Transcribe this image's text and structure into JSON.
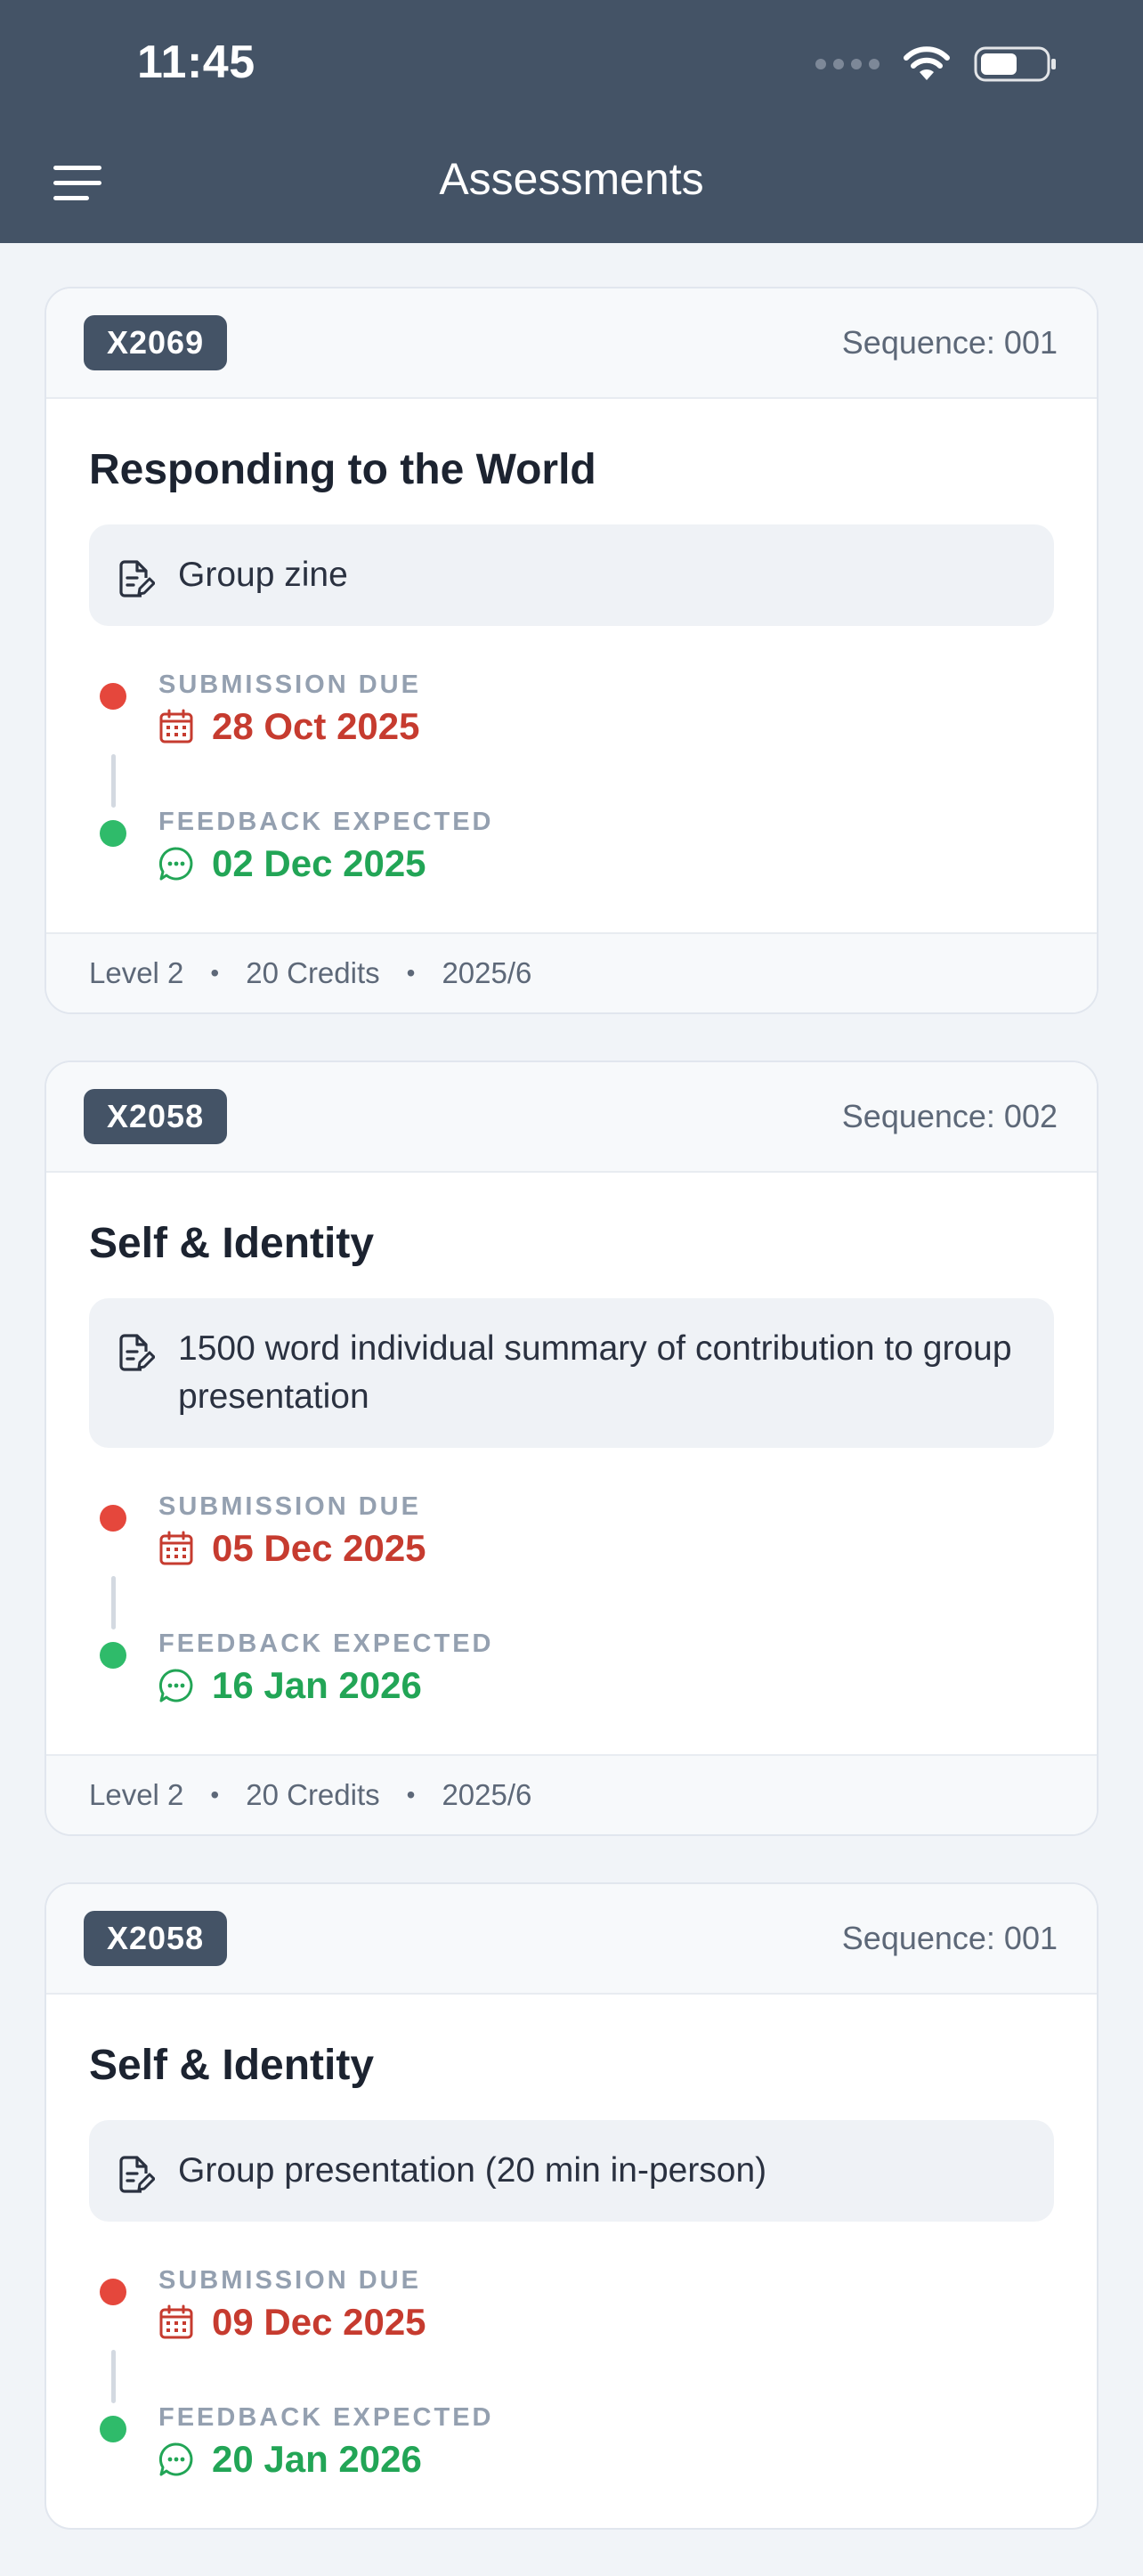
{
  "status_bar": {
    "time": "11:45"
  },
  "header": {
    "title": "Assessments"
  },
  "assessments": [
    {
      "code": "X2069",
      "sequence": "Sequence: 001",
      "title": "Responding to the World",
      "description": "Group zine",
      "submission_label": "SUBMISSION DUE",
      "submission_date": "28 Oct 2025",
      "feedback_label": "FEEDBACK EXPECTED",
      "feedback_date": "02 Dec 2025",
      "level": "Level 2",
      "credits": "20 Credits",
      "year": "2025/6"
    },
    {
      "code": "X2058",
      "sequence": "Sequence: 002",
      "title": "Self & Identity",
      "description": "1500 word individual summary of contribution to group presentation",
      "submission_label": "SUBMISSION DUE",
      "submission_date": "05 Dec 2025",
      "feedback_label": "FEEDBACK EXPECTED",
      "feedback_date": "16 Jan 2026",
      "level": "Level 2",
      "credits": "20 Credits",
      "year": "2025/6"
    },
    {
      "code": "X2058",
      "sequence": "Sequence: 001",
      "title": "Self & Identity",
      "description": "Group presentation (20 min in-person)",
      "submission_label": "SUBMISSION DUE",
      "submission_date": "09 Dec 2025",
      "feedback_label": "FEEDBACK EXPECTED",
      "feedback_date": "20 Jan 2026"
    }
  ],
  "icons": {
    "menu": "hamburger-menu-icon",
    "description": "document-edit-icon",
    "submission": "calendar-icon",
    "feedback": "chat-bubble-icon"
  },
  "colors": {
    "header_bg": "#445366",
    "due_red": "#c63b2f",
    "feedback_green": "#22a556"
  }
}
